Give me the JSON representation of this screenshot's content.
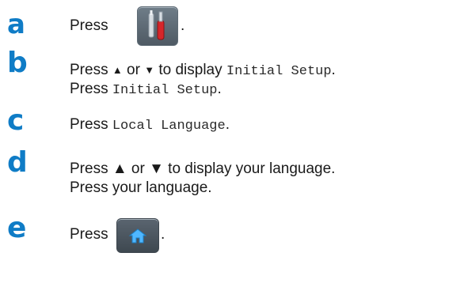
{
  "steps": [
    {
      "letter": "a",
      "lines": [
        {
          "prefix": "Press",
          "icon": "tools-icon",
          "suffix": "."
        }
      ]
    },
    {
      "letter": "b",
      "lines": [
        {
          "press": "Press",
          "up": "▲",
          "or": "or",
          "down": "▼",
          "to_display": "to display",
          "target": "Initial Setup",
          "end": "."
        },
        {
          "press": "Press",
          "target": "Initial Setup",
          "end": "."
        }
      ]
    },
    {
      "letter": "c",
      "lines": [
        {
          "press": "Press",
          "target": "Local Language",
          "end": "."
        }
      ]
    },
    {
      "letter": "d",
      "lines": [
        {
          "text": "Press ▲ or ▼ to display your language."
        },
        {
          "text": "Press your language."
        }
      ]
    },
    {
      "letter": "e",
      "lines": [
        {
          "prefix": "Press",
          "icon": "home-icon",
          "suffix": "."
        }
      ]
    }
  ],
  "colors": {
    "step_letter": "#0f7cc6",
    "text": "#1a1a1a",
    "button_bg": "#5b6771"
  }
}
